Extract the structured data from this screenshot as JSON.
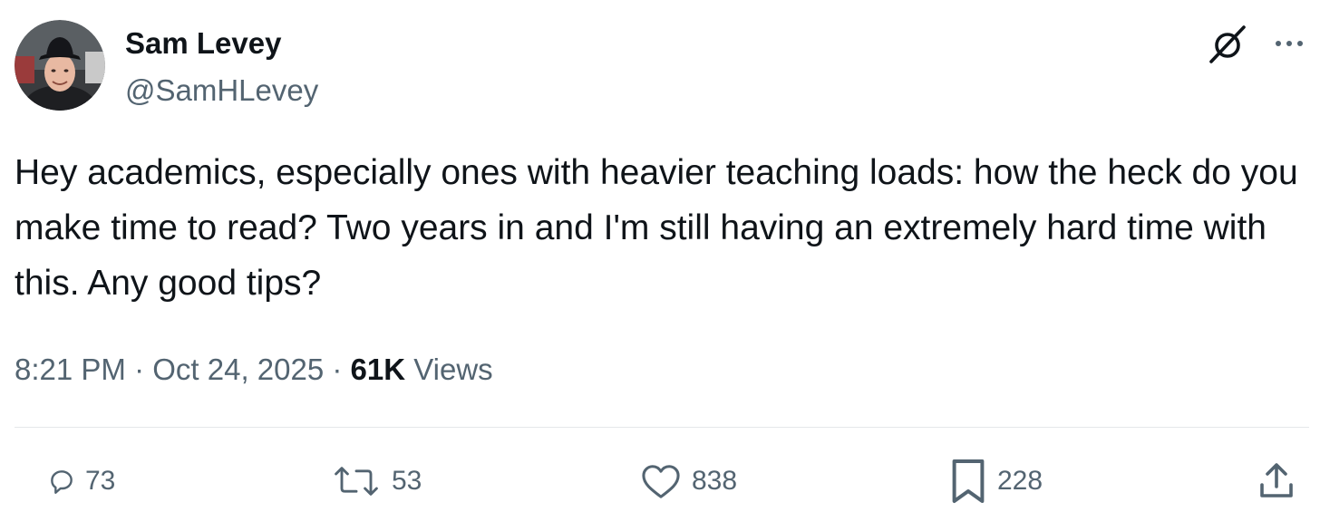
{
  "author": {
    "name": "Sam Levey",
    "handle": "@SamHLevey"
  },
  "icons": {
    "grok": "grok-icon",
    "more": "more-icon",
    "reply": "reply-icon",
    "repost": "repost-icon",
    "like": "heart-icon",
    "bookmark": "bookmark-icon",
    "share": "share-icon"
  },
  "tweet": {
    "text": "Hey academics, especially ones with heavier teaching loads: how the heck do you make time to read? Two years in and I'm still having an extremely hard time with this. Any good tips?"
  },
  "meta": {
    "time": "8:21 PM",
    "separator1": " · ",
    "date": "Oct 24, 2025",
    "separator2": " · ",
    "views_count": "61K",
    "views_label": " Views"
  },
  "actions": {
    "replies": "73",
    "reposts": "53",
    "likes": "838",
    "bookmarks": "228"
  },
  "colors": {
    "text": "#0f1419",
    "secondary": "#536471",
    "divider": "#e5e7ea"
  }
}
